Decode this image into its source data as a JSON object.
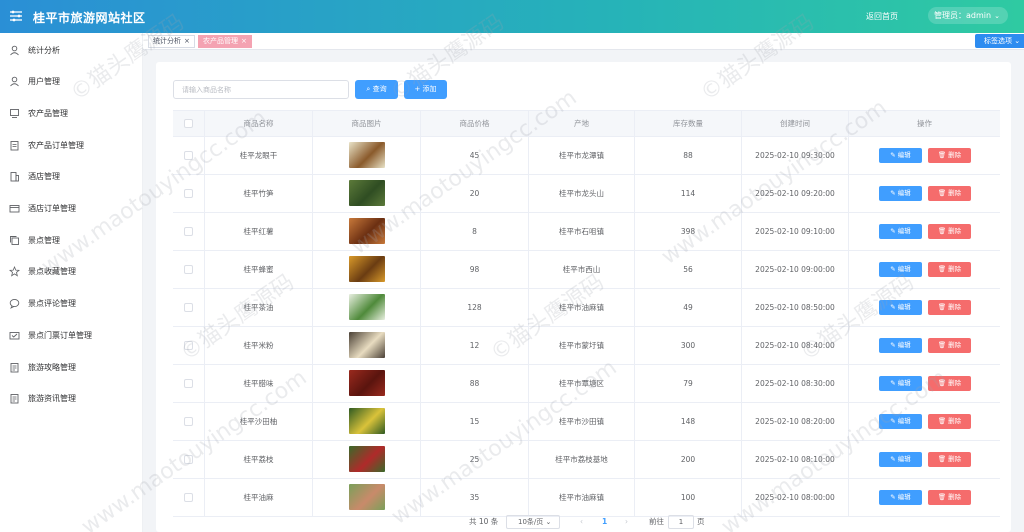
{
  "header": {
    "title": "桂平市旅游网站社区",
    "home_link": "返回首页",
    "user_label": "管理员：admin",
    "gradient_colors": [
      "#2a8fd6",
      "#26b3b8",
      "#2fcaa2"
    ]
  },
  "sidebar": {
    "items": [
      {
        "label": "统计分析",
        "icon": "user-icon"
      },
      {
        "label": "用户管理",
        "icon": "user-icon"
      },
      {
        "label": "农产品管理",
        "icon": "monitor-icon"
      },
      {
        "label": "农产品订单管理",
        "icon": "clipboard-icon"
      },
      {
        "label": "酒店管理",
        "icon": "building-icon"
      },
      {
        "label": "酒店订单管理",
        "icon": "card-icon"
      },
      {
        "label": "景点管理",
        "icon": "copy-icon"
      },
      {
        "label": "景点收藏管理",
        "icon": "star-icon"
      },
      {
        "label": "景点评论管理",
        "icon": "chat-icon"
      },
      {
        "label": "景点门票订单管理",
        "icon": "ticket-icon"
      },
      {
        "label": "旅游攻略管理",
        "icon": "document-icon"
      },
      {
        "label": "旅游资讯管理",
        "icon": "document-icon"
      }
    ]
  },
  "tabs": {
    "items": [
      {
        "label": "统计分析",
        "active": false
      },
      {
        "label": "农产品管理",
        "active": true
      }
    ],
    "options_label": "标签选项"
  },
  "toolbar": {
    "search_placeholder": "请输入商品名称",
    "query_label": "查询",
    "add_label": "添加"
  },
  "table": {
    "columns": [
      "商品名称",
      "商品图片",
      "商品价格",
      "产地",
      "库存数量",
      "创建时间",
      "操作"
    ],
    "edit_label": "编辑",
    "delete_label": "删除",
    "rows": [
      {
        "name": "桂平龙眼干",
        "price": "45",
        "origin": "桂平市龙潭镇",
        "stock": "88",
        "created": "2025-02-10 09:30:00",
        "thumb_colors": [
          "#e9e3c8",
          "#8a5a2b"
        ]
      },
      {
        "name": "桂平竹笋",
        "price": "20",
        "origin": "桂平市龙头山",
        "stock": "114",
        "created": "2025-02-10 09:20:00",
        "thumb_colors": [
          "#5c7a3a",
          "#2f4d22"
        ]
      },
      {
        "name": "桂平红薯",
        "price": "8",
        "origin": "桂平市石咀镇",
        "stock": "398",
        "created": "2025-02-10 09:10:00",
        "thumb_colors": [
          "#c8793a",
          "#6b2f12"
        ]
      },
      {
        "name": "桂平蜂蜜",
        "price": "98",
        "origin": "桂平市西山",
        "stock": "56",
        "created": "2025-02-10 09:00:00",
        "thumb_colors": [
          "#d99a2a",
          "#6a3c12"
        ]
      },
      {
        "name": "桂平茶油",
        "price": "128",
        "origin": "桂平市油麻镇",
        "stock": "49",
        "created": "2025-02-10 08:50:00",
        "thumb_colors": [
          "#e8efe0",
          "#4f8a3a"
        ]
      },
      {
        "name": "桂平米粉",
        "price": "12",
        "origin": "桂平市蒙圩镇",
        "stock": "300",
        "created": "2025-02-10 08:40:00",
        "thumb_colors": [
          "#4a4036",
          "#e8dcc0"
        ]
      },
      {
        "name": "桂平腊味",
        "price": "88",
        "origin": "桂平市覃塘区",
        "stock": "79",
        "created": "2025-02-10 08:30:00",
        "thumb_colors": [
          "#9a2a1e",
          "#5a140e"
        ]
      },
      {
        "name": "桂平沙田柚",
        "price": "15",
        "origin": "桂平市沙田镇",
        "stock": "148",
        "created": "2025-02-10 08:20:00",
        "thumb_colors": [
          "#2f5a22",
          "#d9c23a"
        ]
      },
      {
        "name": "桂平荔枝",
        "price": "25",
        "origin": "桂平市荔枝基地",
        "stock": "200",
        "created": "2025-02-10 08:10:00",
        "thumb_colors": [
          "#3a6a2a",
          "#b02a2a"
        ]
      },
      {
        "name": "桂平油麻",
        "price": "35",
        "origin": "桂平市油麻镇",
        "stock": "100",
        "created": "2025-02-10 08:00:00",
        "thumb_colors": [
          "#7aa05a",
          "#c98a6a"
        ]
      }
    ]
  },
  "pagination": {
    "total_label": "共 10 条",
    "page_size_label": "10条/页",
    "current_page": "1",
    "goto_label": "前往",
    "goto_value": "1",
    "page_suffix": "页"
  },
  "watermark": {
    "texts": [
      "©猫头鹰源码",
      "www.maotouyingcc.com"
    ]
  },
  "colors": {
    "primary": "#409eff",
    "danger": "#f56c6c",
    "active_tab": "#f4a3b2"
  }
}
